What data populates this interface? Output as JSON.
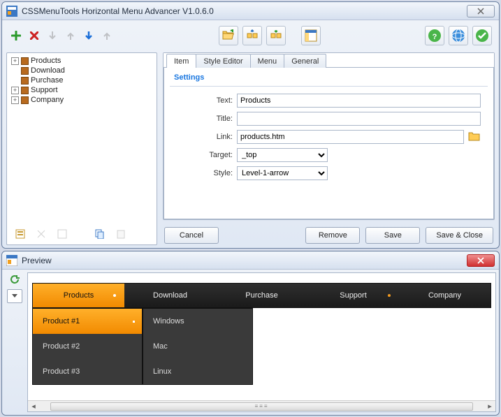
{
  "window": {
    "title": "CSSMenuTools Horizontal Menu Advancer V1.0.6.0"
  },
  "toolbar": {
    "add": "add",
    "delete": "delete",
    "move_down_sel": "move down",
    "move_up": "move up",
    "move_down": "move down blue",
    "move_up_gray": "move up gray"
  },
  "tree": {
    "items": [
      {
        "label": "Products",
        "expandable": true,
        "sign": "+"
      },
      {
        "label": "Download",
        "expandable": false
      },
      {
        "label": "Purchase",
        "expandable": false
      },
      {
        "label": "Support",
        "expandable": true,
        "sign": "+"
      },
      {
        "label": "Company",
        "expandable": true,
        "sign": "+"
      }
    ]
  },
  "tabs": {
    "items": [
      {
        "label": "Item"
      },
      {
        "label": "Style Editor"
      },
      {
        "label": "Menu"
      },
      {
        "label": "General"
      }
    ],
    "active": 0
  },
  "settings": {
    "heading": "Settings",
    "labels": {
      "text": "Text:",
      "title": "Title:",
      "link": "Link:",
      "target": "Target:",
      "style": "Style:"
    },
    "values": {
      "text": "Products",
      "title": "",
      "link": "products.htm",
      "target": "_top",
      "style": "Level-1-arrow"
    }
  },
  "buttons": {
    "cancel": "Cancel",
    "remove": "Remove",
    "save": "Save",
    "save_close": "Save & Close"
  },
  "preview": {
    "title": "Preview",
    "menu": [
      "Products",
      "Download",
      "Purchase",
      "Support",
      "Company"
    ],
    "menu_arrows": [
      true,
      false,
      false,
      true,
      false
    ],
    "active_menu": 0,
    "submenu1": [
      "Product #1",
      "Product #2",
      "Product #3"
    ],
    "submenu1_active": 0,
    "submenu2": [
      "Windows",
      "Mac",
      "Linux"
    ]
  }
}
